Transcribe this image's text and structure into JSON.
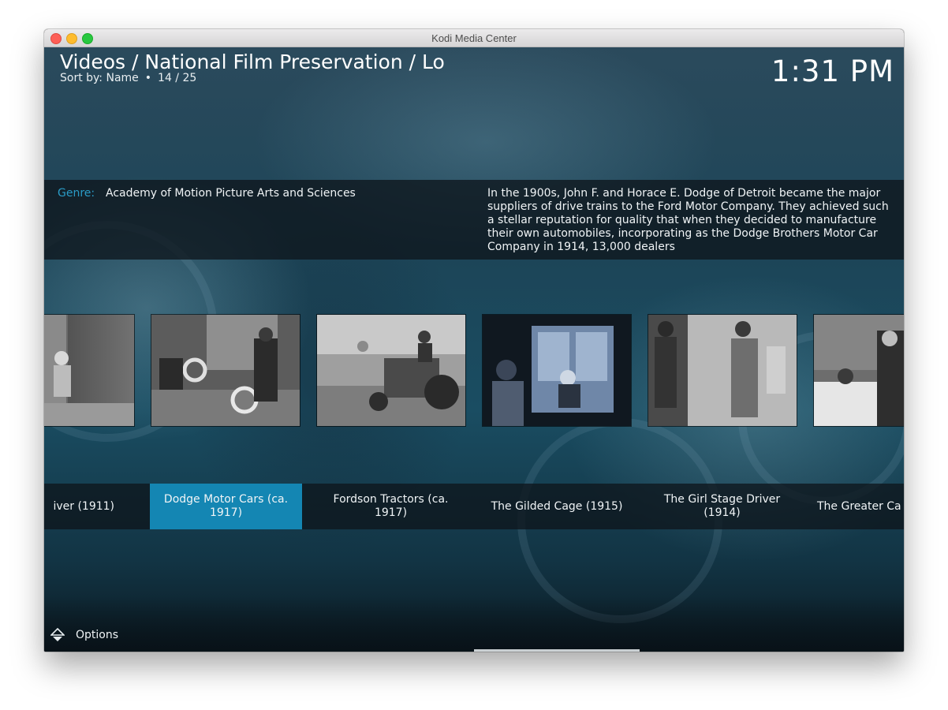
{
  "window": {
    "title": "Kodi Media Center"
  },
  "header": {
    "path": "Videos / National Film Preservation  / Lo",
    "sort_label": "Sort by: Name",
    "dot": "•",
    "position": "14 / 25",
    "clock": "1:31 PM"
  },
  "info": {
    "genre_label": "Genre:",
    "genre_value": "Academy of Motion Picture Arts and Sciences",
    "plot": "In the 1900s, John F. and Horace E. Dodge of Detroit became the major suppliers of drive trains to the Ford Motor Company.  They achieved such a stellar reputation for quality that when they decided to manufacture their own automobiles, incorporating as the Dodge Brothers Motor Car Company in 1914, 13,000 dealers"
  },
  "items": [
    {
      "label": "iver (1911)",
      "selected": false
    },
    {
      "label": "Dodge Motor Cars (ca. 1917)",
      "selected": true
    },
    {
      "label": "Fordson Tractors (ca. 1917)",
      "selected": false
    },
    {
      "label": "The Gilded Cage (1915)",
      "selected": false
    },
    {
      "label": "The Girl Stage Driver (1914)",
      "selected": false
    },
    {
      "label": "The Greater Ca",
      "selected": false
    }
  ],
  "footer": {
    "options_label": "Options"
  },
  "colors": {
    "accent": "#1486b3",
    "genre_label": "#2a9bc6"
  }
}
